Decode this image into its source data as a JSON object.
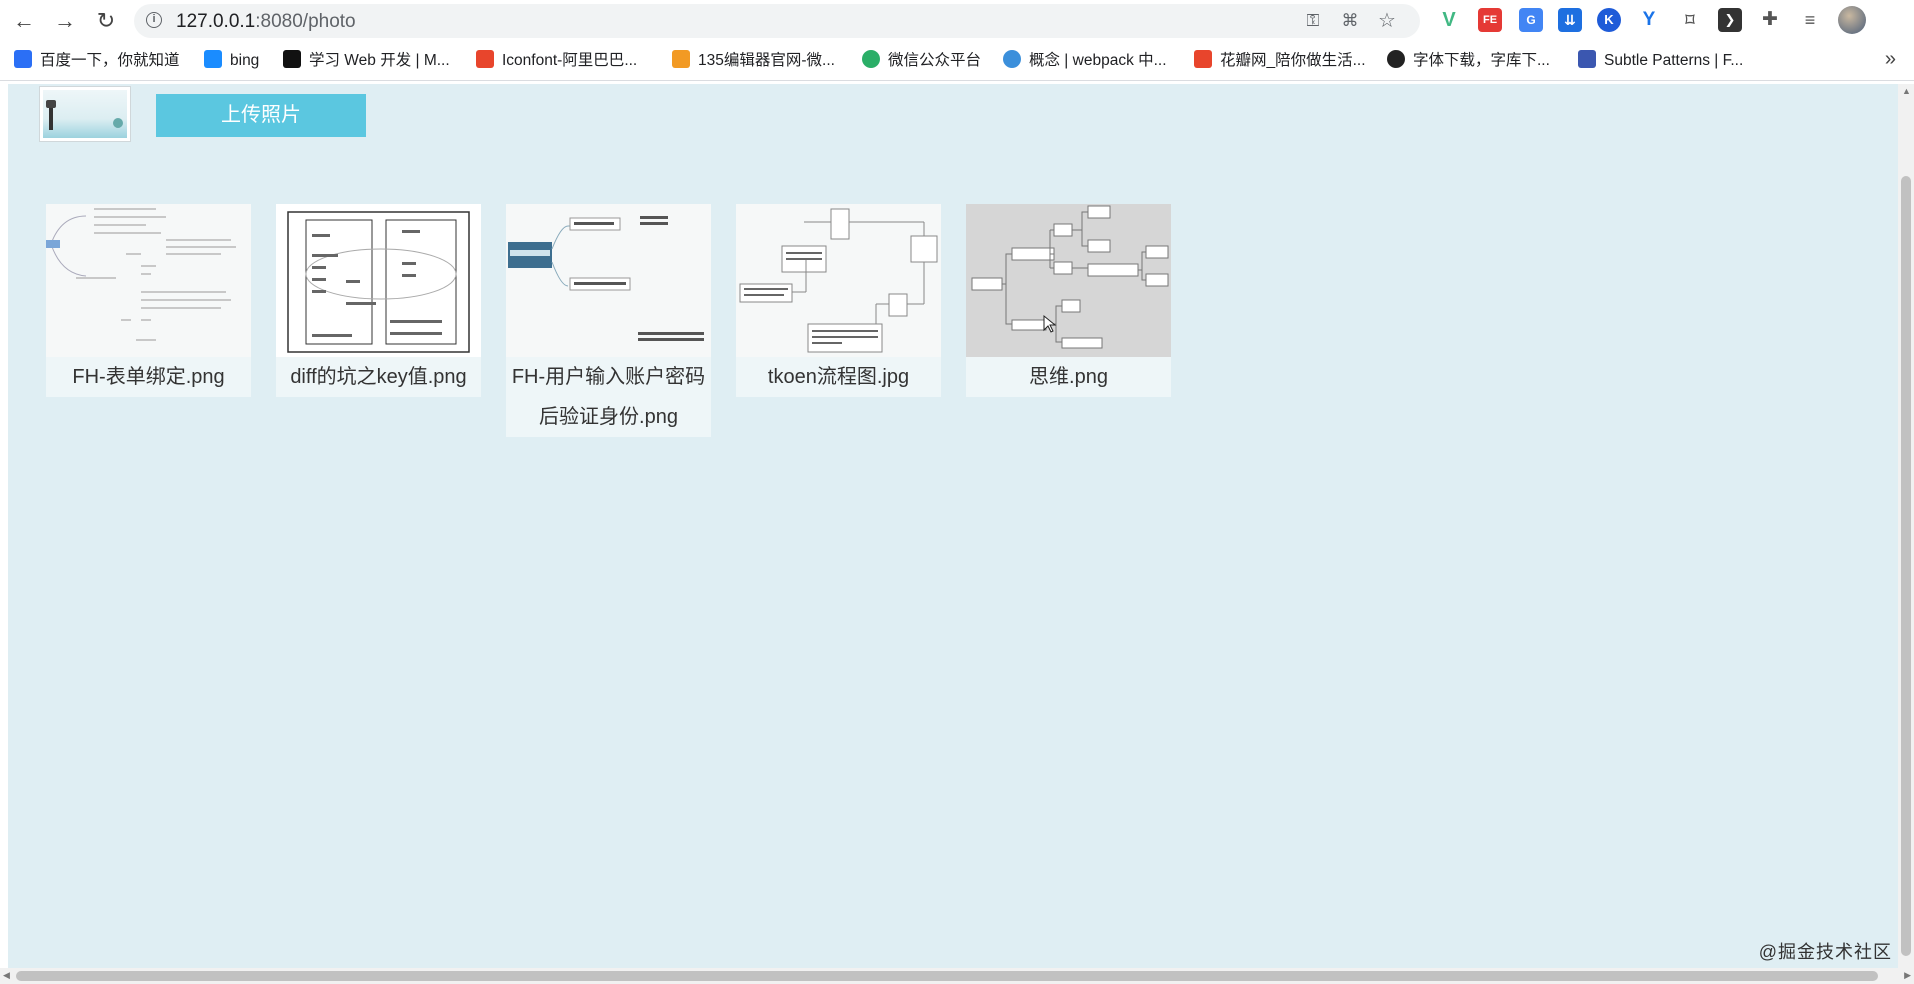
{
  "browser": {
    "url_host": "127.0.0.1",
    "url_port_path": ":8080/photo"
  },
  "bookmarks": [
    {
      "label": "百度一下，你就知道",
      "color": "#2b6ff5"
    },
    {
      "label": "bing",
      "color": "#1a8cff"
    },
    {
      "label": "学习 Web 开发 | M...",
      "color": "#111111"
    },
    {
      "label": "Iconfont-阿里巴巴...",
      "color": "#e8452c"
    },
    {
      "label": "135编辑器官网-微...",
      "color": "#f29a24"
    },
    {
      "label": "微信公众平台",
      "color": "#2aae67"
    },
    {
      "label": "概念 | webpack 中...",
      "color": "#3b8fdb"
    },
    {
      "label": "花瓣网_陪你做生活...",
      "color": "#e8452c"
    },
    {
      "label": "字体下载，字库下...",
      "color": "#222222"
    },
    {
      "label": "Subtle Patterns | F...",
      "color": "#3b57b0"
    }
  ],
  "upload_button": "上传照片",
  "photos": [
    {
      "name": "FH-表单绑定.png"
    },
    {
      "name": "diff的坑之key值.png"
    },
    {
      "name_line1": "FH-用户输入账户密码",
      "name_line2": "后验证身份.png"
    },
    {
      "name": "tkoen流程图.jpg"
    },
    {
      "name": "思维.png"
    }
  ],
  "watermark": "@掘金技术社区"
}
